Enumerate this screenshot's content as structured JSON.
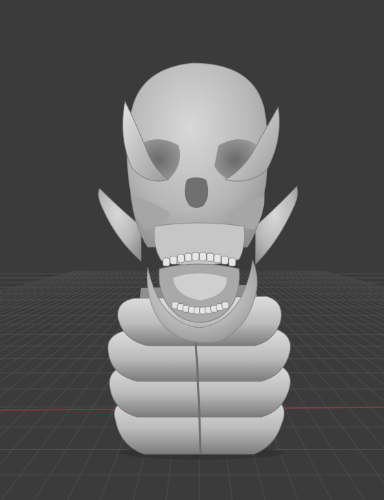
{
  "viewport": {
    "background_color": "#3b3b3b",
    "grid_line_color": "#4d4d4d",
    "x_axis_color": "#8a3c44",
    "model_color": "#bdbdbd",
    "model_shadow_color": "#6a6a6a",
    "model_highlight_color": "#e2e2e2",
    "model_dark_color": "#2e2e2e",
    "model": "horned-skull-bust",
    "shading": "solid",
    "overlays": [
      "floor-grid",
      "x-axis-line"
    ]
  }
}
